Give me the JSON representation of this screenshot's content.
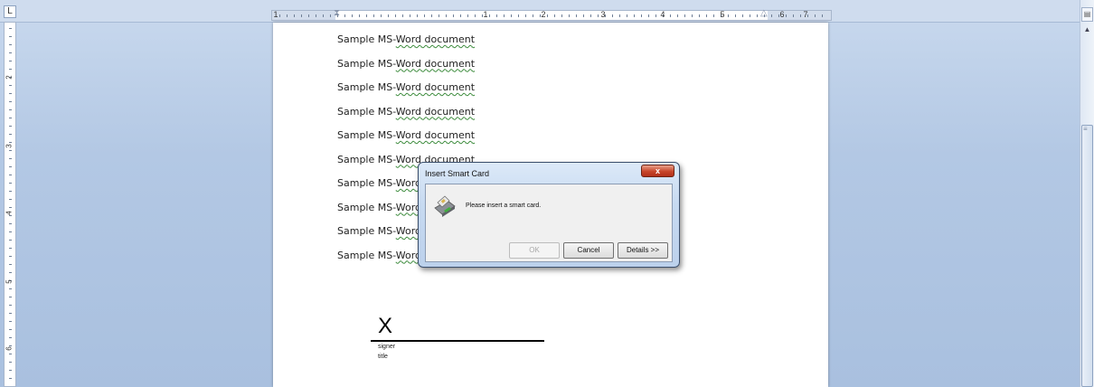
{
  "ruler": {
    "corner_icon": "tab-stop-icon",
    "numbers": [
      "1",
      "1",
      "2",
      "3",
      "4",
      "5",
      "6",
      "7"
    ],
    "vertical_numbers": [
      "2",
      "3",
      "4",
      "5",
      "6"
    ]
  },
  "document": {
    "lines": [
      {
        "prefix": "Sample MS-",
        "spell": "Word document"
      },
      {
        "prefix": "Sample MS-",
        "spell": "Word document"
      },
      {
        "prefix": "Sample MS-",
        "spell": "Word document"
      },
      {
        "prefix": "Sample MS-",
        "spell": "Word document"
      },
      {
        "prefix": "Sample MS-",
        "spell": "Word document"
      },
      {
        "prefix": "Sample MS-",
        "spell": "Word document"
      },
      {
        "prefix": "Sample MS-",
        "spell": "Word d"
      },
      {
        "prefix": "Sample MS-",
        "spell": "Word d"
      },
      {
        "prefix": "Sample MS-",
        "spell": "Word d"
      },
      {
        "prefix": "Sample MS-",
        "spell": "Word d"
      }
    ],
    "signature": {
      "mark": "X",
      "signer": "signer",
      "title": "title"
    }
  },
  "dialog": {
    "title": "Insert Smart Card",
    "close_label": "x",
    "message": "Please insert a smart card.",
    "icon": "smart-card-reader-icon",
    "buttons": {
      "ok": "OK",
      "cancel": "Cancel",
      "details": "Details >>"
    }
  },
  "colors": {
    "workspace": "#b3c8e4",
    "spellcheck_underline": "#3a8a3a",
    "close_button": "#c8452a"
  }
}
